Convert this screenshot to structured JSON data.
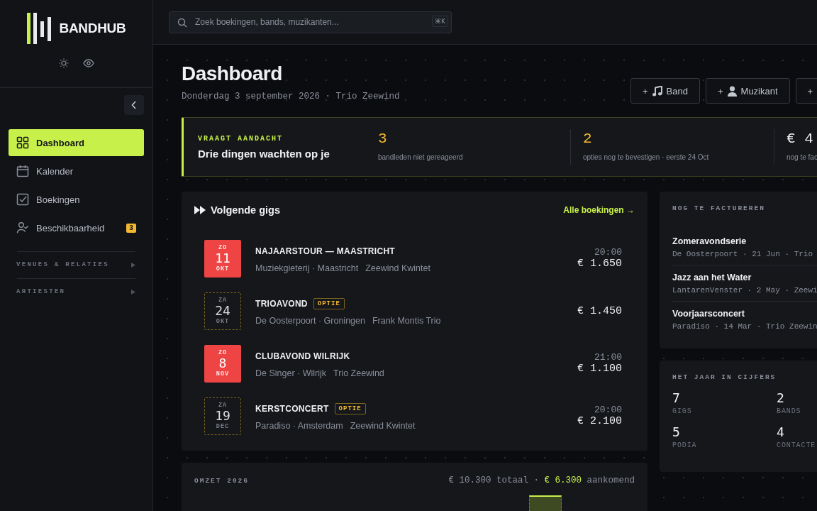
{
  "brand": {
    "name": "BANDHUB"
  },
  "search": {
    "placeholder": "Zoek boekingen, bands, muzikanten...",
    "shortcut": "⌘K"
  },
  "nav": [
    {
      "label": "Dashboard",
      "kind": "grid",
      "selected": true
    },
    {
      "label": "Kalender",
      "kind": "calendar",
      "selected": false
    },
    {
      "label": "Boekingen",
      "kind": "check",
      "selected": false
    },
    {
      "label": "Beschikbaarheid",
      "kind": "user",
      "selected": false,
      "badge": "3"
    }
  ],
  "nav_sections": [
    {
      "label": "VENUES & RELATIES",
      "expanded": false
    },
    {
      "label": "ARTIESTEN",
      "expanded": false
    }
  ],
  "page": {
    "title": "Dashboard",
    "subtitle": "Donderdag 3 september 2026 · Trio Zeewind"
  },
  "actions": [
    {
      "plus": "+",
      "kind": "music",
      "label": "Band"
    },
    {
      "plus": "+",
      "kind": "person",
      "label": "Muzikant"
    },
    {
      "plus": "+"
    }
  ],
  "attention": {
    "eyebrow": "VRAAGT AANDACHT",
    "title": "Drie dingen wachten op je",
    "items": [
      {
        "value": "3",
        "label": "bandleden niet gereageerd",
        "color": "#f5b82e"
      },
      {
        "value": "2",
        "label": "opties nog te bevestigen · eerste 24 Oct",
        "color": "#f5b82e"
      },
      {
        "value": "€ 4",
        "label": "nog te fac",
        "color": "#eef0f3"
      }
    ]
  },
  "gigs": {
    "title": "Volgende gigs",
    "link": "Alle boekingen →",
    "items": [
      {
        "weekday": "ZO",
        "day": "11",
        "month": "OKT",
        "kind": "confirmed",
        "title": "NAJAARSTOUR — MAASTRICHT",
        "place": "Muziekgieterij · Maastricht",
        "band": "Zeewind Kwintet",
        "time": "20:00",
        "fee": "€ 1.650"
      },
      {
        "weekday": "ZA",
        "day": "24",
        "month": "OKT",
        "kind": "option",
        "badge": "OPTIE",
        "title": "TRIOAVOND",
        "place": "De Oosterpoort · Groningen",
        "band": "Frank Montis Trio",
        "fee": "€ 1.450"
      },
      {
        "weekday": "ZO",
        "day": "8",
        "month": "NOV",
        "kind": "confirmed",
        "title": "CLUBAVOND WILRIJK",
        "place": "De Singer · Wilrijk",
        "band": "Trio Zeewind",
        "time": "21:00",
        "fee": "€ 1.100"
      },
      {
        "weekday": "ZA",
        "day": "19",
        "month": "DEC",
        "kind": "option",
        "badge": "OPTIE",
        "title": "KERSTCONCERT",
        "place": "Paradiso · Amsterdam",
        "band": "Zeewind Kwintet",
        "time": "20:00",
        "fee": "€ 2.100"
      }
    ]
  },
  "invoices": {
    "title": "NOG TE FACTUREREN",
    "items": [
      {
        "title": "Zomeravondserie",
        "meta": "De Oosterpoort · 21 Jun · Trio"
      },
      {
        "title": "Jazz aan het Water",
        "meta": "LantarenVenster · 2 May · Zeewi"
      },
      {
        "title": "Voorjaarsconcert",
        "meta": "Paradiso · 14 Mar · Trio Zeewin"
      }
    ]
  },
  "year": {
    "title": "HET JAAR IN CIJFERS",
    "stats": [
      {
        "value": "7",
        "label": "GIGS"
      },
      {
        "value": "2",
        "label": "BANDS"
      },
      {
        "value": "5",
        "label": "PODIA"
      },
      {
        "value": "4",
        "label": "CONTACTE"
      }
    ]
  },
  "revenue": {
    "title": "OMZET 2026",
    "total": "€ 10.300 totaal ·",
    "upcoming": "€ 6.300",
    "upcoming_label": "aankomend"
  }
}
